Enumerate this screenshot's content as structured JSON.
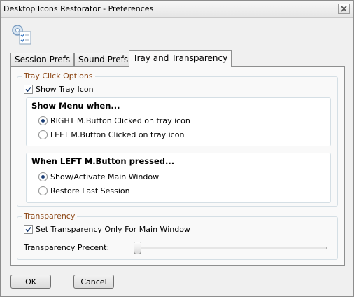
{
  "window": {
    "title": "Desktop Icons Restorator - Preferences"
  },
  "icons": {
    "app": "settings-list-icon",
    "close": "close-icon"
  },
  "tabs": [
    {
      "label": "Session Prefs",
      "active": false
    },
    {
      "label": "Sound Prefs",
      "active": false
    },
    {
      "label": "Tray and Transparency",
      "active": true
    }
  ],
  "tray_click": {
    "legend": "Tray Click Options",
    "show_tray_icon": {
      "label": "Show Tray Icon",
      "checked": true
    },
    "show_menu": {
      "title": "Show Menu when...",
      "options": [
        {
          "label": "RIGHT M.Button Clicked on tray icon",
          "selected": true
        },
        {
          "label": "LEFT M.Button Clicked on tray icon",
          "selected": false
        }
      ]
    },
    "left_pressed": {
      "title": "When LEFT M.Button pressed...",
      "options": [
        {
          "label": "Show/Activate Main Window",
          "selected": true
        },
        {
          "label": "Restore Last Session",
          "selected": false
        }
      ]
    }
  },
  "transparency": {
    "legend": "Transparency",
    "main_only": {
      "label": "Set Transparency Only For Main Window",
      "checked": true
    },
    "percent_label": "Transparency Precent:",
    "slider_value": 0
  },
  "buttons": {
    "ok": "OK",
    "cancel": "Cancel"
  },
  "colors": {
    "legend": "#8b4513",
    "radio_dot": "#1b3d75"
  }
}
